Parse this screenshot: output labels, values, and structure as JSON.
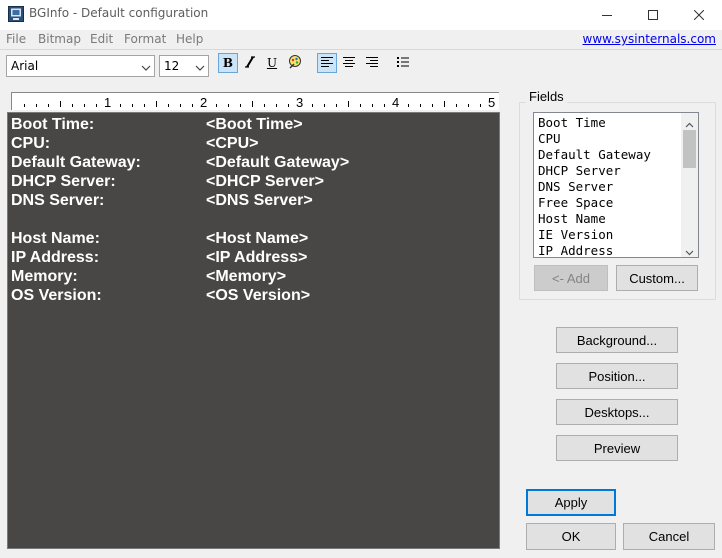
{
  "window": {
    "title": "BGInfo - Default configuration",
    "controls": {
      "minimize": "minimize-icon",
      "maximize": "maximize-icon",
      "close": "close-icon"
    }
  },
  "menu": {
    "items": [
      "File",
      "Bitmap",
      "Edit",
      "Format",
      "Help"
    ],
    "link": "www.sysinternals.com"
  },
  "toolbar": {
    "font_name": "Arial",
    "font_size": "12",
    "bold_label": "B",
    "italic_label": "I",
    "underline_label": "U",
    "buttons": [
      "bold-icon",
      "italic-icon",
      "underline-icon",
      "color-icon",
      "align-left-icon",
      "align-center-icon",
      "align-right-icon",
      "bullets-icon"
    ]
  },
  "ruler": {
    "numbers": [
      "1",
      "2",
      "3",
      "4",
      "5"
    ]
  },
  "editor": {
    "background": "#494745",
    "lines": [
      {
        "label": "Boot Time:",
        "value": "<Boot Time>"
      },
      {
        "label": "CPU:",
        "value": "<CPU>"
      },
      {
        "label": "Default Gateway:",
        "value": "<Default Gateway>"
      },
      {
        "label": "DHCP Server:",
        "value": "<DHCP Server>"
      },
      {
        "label": "DNS Server:",
        "value": "<DNS Server>"
      },
      {
        "label": "",
        "value": ""
      },
      {
        "label": "Host Name:",
        "value": "<Host Name>"
      },
      {
        "label": "IP Address:",
        "value": "<IP Address>"
      },
      {
        "label": "Memory:",
        "value": "<Memory>"
      },
      {
        "label": "OS Version:",
        "value": "<OS Version>"
      }
    ]
  },
  "fields": {
    "label": "Fields",
    "items": [
      "Boot Time",
      "CPU",
      "Default Gateway",
      "DHCP Server",
      "DNS Server",
      "Free Space",
      "Host Name",
      "IE Version",
      "IP Address"
    ],
    "add_label": "<- Add",
    "custom_label": "Custom..."
  },
  "buttons": {
    "background": "Background...",
    "position": "Position...",
    "desktops": "Desktops...",
    "preview": "Preview",
    "apply": "Apply",
    "ok": "OK",
    "cancel": "Cancel"
  }
}
